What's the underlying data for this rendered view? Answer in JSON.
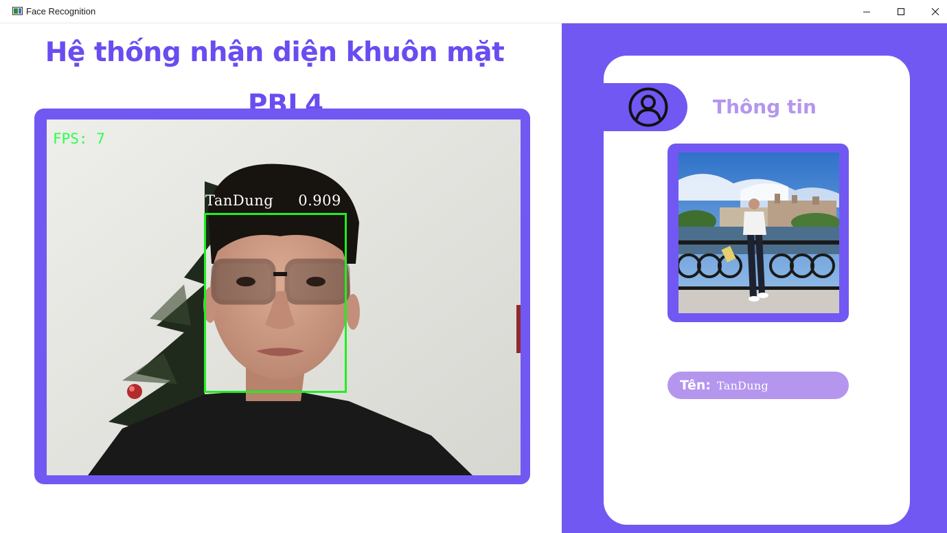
{
  "window": {
    "title": "Face Recognition",
    "controls": [
      "minimize-icon",
      "maximize-icon",
      "close-icon"
    ]
  },
  "header": {
    "title": "Hệ thống nhận diện khuôn mặt",
    "subtitle": "PBL4"
  },
  "camera": {
    "fps_text": "FPS: 7",
    "detection": {
      "name": "TanDung",
      "score": "0.909"
    }
  },
  "info_panel": {
    "title": "Thông tin",
    "icon": "user-circle-icon",
    "name_label": "Tên:",
    "name_value": "TanDung"
  },
  "colors": {
    "accent": "#7158f2",
    "title_text": "#6a4cf1",
    "secondary": "#b496ee",
    "detection_box": "#1fef1f"
  }
}
